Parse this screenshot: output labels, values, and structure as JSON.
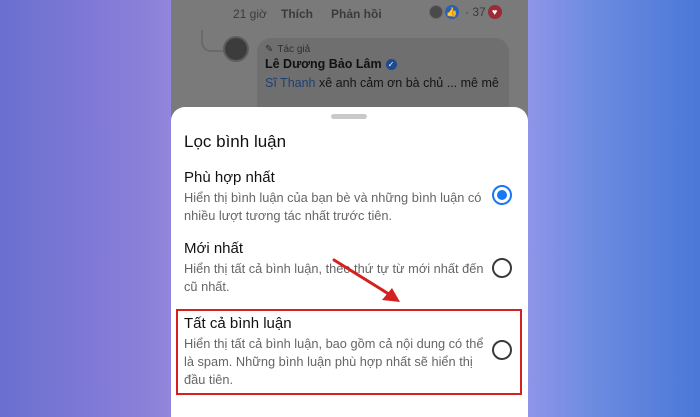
{
  "feed": {
    "time": "21 giờ",
    "like_label": "Thích",
    "reply_label": "Phản hồi",
    "reaction_count": "37",
    "reply": {
      "author_tag": "Tác giả",
      "author_name": "Lê Dương Bảo Lâm",
      "mention": "Sĩ Thanh",
      "text": "xê anh cảm ơn bà chủ ... mê mê"
    }
  },
  "sheet": {
    "title": "Lọc bình luận",
    "options": [
      {
        "title": "Phù hợp nhất",
        "description": "Hiển thị bình luận của bạn bè và những bình luận có nhiều lượt tương tác nhất trước tiên.",
        "selected": true
      },
      {
        "title": "Mới nhất",
        "description": "Hiển thị tất cả bình luận, theo thứ tự từ mới nhất đến cũ nhất.",
        "selected": false
      },
      {
        "title": "Tất cả bình luận",
        "description": "Hiển thị tất cả bình luận, bao gồm cả nội dung có thể là spam. Những bình luận phù hợp nhất sẽ hiển thị đầu tiên.",
        "selected": false
      }
    ]
  },
  "colors": {
    "accent": "#1877f2",
    "annotation": "#d52020"
  },
  "icons": [
    "pencil-icon",
    "verified-icon",
    "like-reaction-icon",
    "heart-reaction-icon",
    "radio-selected-icon",
    "radio-unselected-icon"
  ]
}
